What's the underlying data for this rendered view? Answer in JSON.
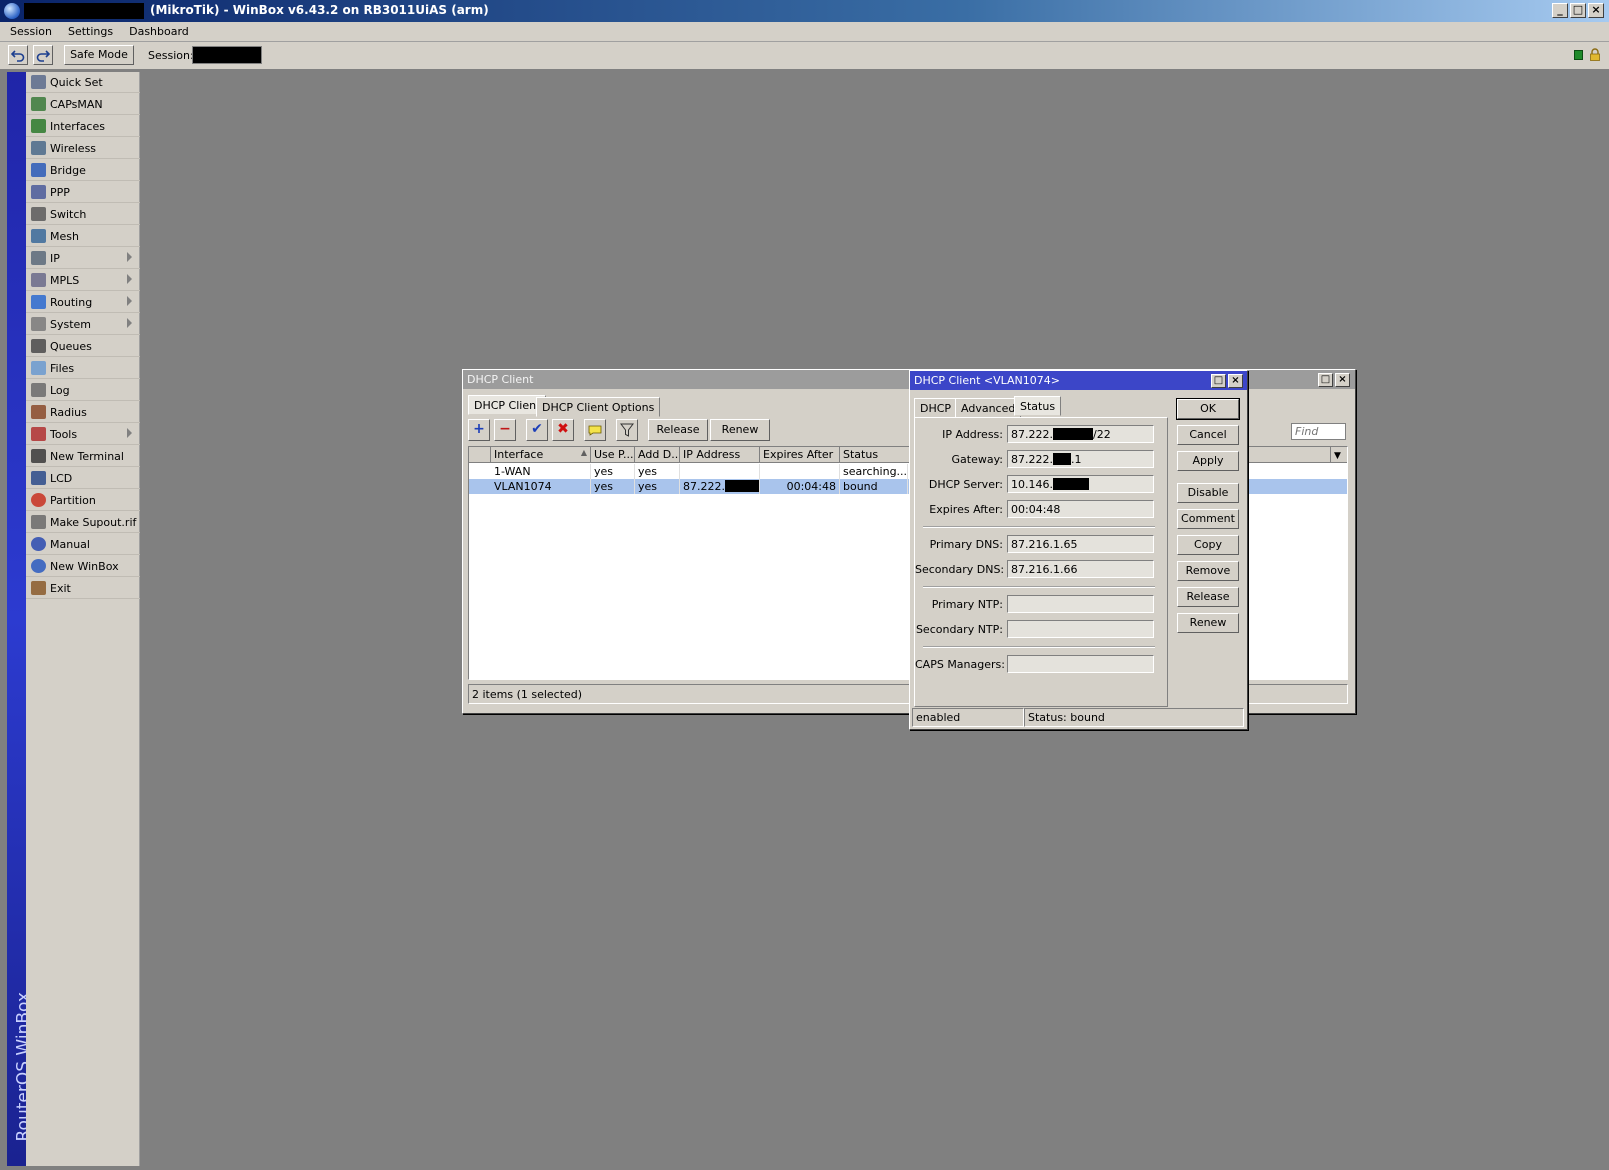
{
  "window": {
    "title": "(MikroTik) - WinBox v6.43.2 on RB3011UiAS (arm)",
    "min_glyph": "_",
    "max_glyph": "□",
    "close_glyph": "×"
  },
  "menubar": {
    "items": [
      "Session",
      "Settings",
      "Dashboard"
    ]
  },
  "toolbar": {
    "undo_icon": "undo-icon",
    "redo_icon": "redo-icon",
    "safe_mode_label": "Safe Mode",
    "session_label": "Session:"
  },
  "sidebar": {
    "brand": "RouterOS WinBox",
    "items": [
      {
        "label": "Quick Set",
        "icon": "wand-icon",
        "submenu": false
      },
      {
        "label": "CAPsMAN",
        "icon": "antenna-icon",
        "submenu": false
      },
      {
        "label": "Interfaces",
        "icon": "ethernet-icon",
        "submenu": false
      },
      {
        "label": "Wireless",
        "icon": "antenna-icon",
        "submenu": false
      },
      {
        "label": "Bridge",
        "icon": "bridge-icon",
        "submenu": false
      },
      {
        "label": "PPP",
        "icon": "ppp-icon",
        "submenu": false
      },
      {
        "label": "Switch",
        "icon": "switch-icon",
        "submenu": false
      },
      {
        "label": "Mesh",
        "icon": "mesh-icon",
        "submenu": false
      },
      {
        "label": "IP",
        "icon": "ip-icon",
        "submenu": true
      },
      {
        "label": "MPLS",
        "icon": "mpls-icon",
        "submenu": true
      },
      {
        "label": "Routing",
        "icon": "routing-icon",
        "submenu": true
      },
      {
        "label": "System",
        "icon": "gear-icon",
        "submenu": true
      },
      {
        "label": "Queues",
        "icon": "queues-icon",
        "submenu": false
      },
      {
        "label": "Files",
        "icon": "folder-icon",
        "submenu": false
      },
      {
        "label": "Log",
        "icon": "log-icon",
        "submenu": false
      },
      {
        "label": "Radius",
        "icon": "radius-icon",
        "submenu": false
      },
      {
        "label": "Tools",
        "icon": "tools-icon",
        "submenu": true
      },
      {
        "label": "New Terminal",
        "icon": "terminal-icon",
        "submenu": false
      },
      {
        "label": "LCD",
        "icon": "lcd-icon",
        "submenu": false
      },
      {
        "label": "Partition",
        "icon": "partition-icon",
        "submenu": false
      },
      {
        "label": "Make Supout.rif",
        "icon": "document-icon",
        "submenu": false
      },
      {
        "label": "Manual",
        "icon": "help-icon",
        "submenu": false
      },
      {
        "label": "New WinBox",
        "icon": "globe-icon",
        "submenu": false
      },
      {
        "label": "Exit",
        "icon": "exit-icon",
        "submenu": false
      }
    ]
  },
  "dhcp_list": {
    "title": "DHCP Client",
    "tabs": [
      "DHCP Client",
      "DHCP Client Options"
    ],
    "buttons": {
      "release": "Release",
      "renew": "Renew"
    },
    "find_placeholder": "Find",
    "columns": [
      "Interface",
      "Use P...",
      "Add D...",
      "IP Address",
      "Expires After",
      "Status"
    ],
    "rows": [
      {
        "interface": "1-WAN",
        "use_peer": "yes",
        "add_default": "yes",
        "ip": "",
        "expires": "",
        "status": "searching...",
        "selected": false
      },
      {
        "interface": "VLAN1074",
        "use_peer": "yes",
        "add_default": "yes",
        "ip": "87.222.",
        "expires": "00:04:48",
        "status": "bound",
        "selected": true
      }
    ],
    "footer": "2 items (1 selected)"
  },
  "dhcp_detail": {
    "title": "DHCP Client <VLAN1074>",
    "tabs": [
      "DHCP",
      "Advanced",
      "Status"
    ],
    "fields": {
      "ip_address": {
        "label": "IP Address:",
        "prefix": "87.222.",
        "suffix": "/22"
      },
      "gateway": {
        "label": "Gateway:",
        "prefix": "87.222.",
        "suffix": ".1"
      },
      "dhcp_server": {
        "label": "DHCP Server:",
        "prefix": "10.146.",
        "suffix": ""
      },
      "expires_after": {
        "label": "Expires After:",
        "value": "00:04:48"
      },
      "primary_dns": {
        "label": "Primary DNS:",
        "value": "87.216.1.65"
      },
      "secondary_dns": {
        "label": "Secondary DNS:",
        "value": "87.216.1.66"
      },
      "primary_ntp": {
        "label": "Primary NTP:",
        "value": ""
      },
      "secondary_ntp": {
        "label": "Secondary NTP:",
        "value": ""
      },
      "caps_managers": {
        "label": "CAPS Managers:",
        "value": ""
      }
    },
    "buttons": [
      "OK",
      "Cancel",
      "Apply",
      "Disable",
      "Comment",
      "Copy",
      "Remove",
      "Release",
      "Renew"
    ],
    "status_left": "enabled",
    "status_right": "Status: bound"
  },
  "colors": {
    "title_gradient_start": "#0a246a",
    "detail_title": "#3c46c8",
    "selected_row": "#a9c4ec",
    "sidebar_stripe": "#2c3bd0"
  }
}
